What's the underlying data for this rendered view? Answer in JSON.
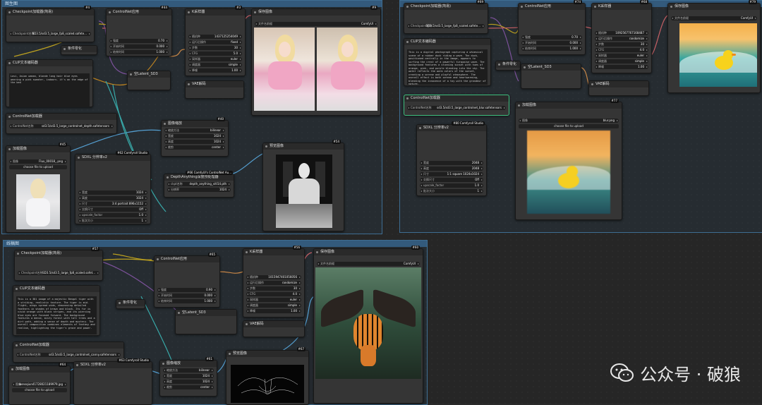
{
  "groups": {
    "g1": {
      "title": "图生图"
    },
    "g2": {
      "title": ""
    },
    "g3": {
      "title": "线稿图"
    }
  },
  "watermark": {
    "text": "公众号 · 破狼",
    "icon": "wechat-icon"
  },
  "panel1": {
    "checkpoint": {
      "title": "Checkpoint加载器(简易)",
      "badge": "#4",
      "widget_label": "Checkpoint名称",
      "widget_value": "SD3.5/sd3.5_large_fp8_scaled.safete..."
    },
    "clip": {
      "title": "CLIP文本编码器",
      "text": "Lovi, Asian woman, blonde long hair blue eyes wearing a pink sweater, indoors. it's on the edge of the bed"
    },
    "neg": {
      "title": "条件零化"
    },
    "controlnet_apply": {
      "title": "ControlNet应用",
      "badge": "#44",
      "rows": [
        [
          "强度",
          "0.70"
        ],
        [
          "开始时间",
          "0.000"
        ],
        [
          "结束时间",
          "1.000"
        ]
      ]
    },
    "ksampler": {
      "title": "K采样器",
      "badge": "#3",
      "rows": [
        [
          "随机种",
          "1437125254049"
        ],
        [
          "运行后操作",
          "fixed"
        ],
        [
          "步数",
          "30"
        ],
        [
          "CFG",
          "5.0"
        ],
        [
          "采样器",
          "euler"
        ],
        [
          "调度器",
          "simple"
        ],
        [
          "降噪",
          "1.00"
        ]
      ]
    },
    "save": {
      "title": "保存图像",
      "badge": "#9",
      "prefix_label": "文件名前缀",
      "prefix_value": "ComfyUI"
    },
    "latent": {
      "title": "空Latent_SD3"
    },
    "vae": {
      "title": "VAE解码"
    },
    "cn_loader": {
      "title": "ControlNet加载器",
      "widget_label": "ControlNet名称",
      "widget_value": "sd3.5/sd3.5_large_controlnet_depth.safetensors"
    },
    "resize": {
      "title": "图像缩放",
      "badge": "#40",
      "rows": [
        [
          "缩放方法",
          "bilinear"
        ],
        [
          "宽度",
          "1024"
        ],
        [
          "高度",
          "1024"
        ],
        [
          "裁剪",
          "center"
        ]
      ]
    },
    "load_img": {
      "title": "加载图像",
      "badge": "#45",
      "file_label": "图像",
      "file_value": "Flux_00018_.png",
      "upload": "choose file to upload"
    },
    "sdxl": {
      "title": "SDXL 分辨率v2",
      "badge": "#62 Comfyroll Studio",
      "rows": [
        [
          "宽度",
          "1024"
        ],
        [
          "高度",
          "1024"
        ],
        [
          "尺寸",
          "3:4 portrait 896x1152"
        ],
        [
          "交换尺寸",
          "Off"
        ],
        [
          "upscale_factor",
          "1.0"
        ],
        [
          "批次大小",
          "1"
        ]
      ]
    },
    "depth": {
      "title": "DepthAnything深度预处理器",
      "badge": "#66 ComfyUI's ControlNet Au...",
      "rows": [
        [
          "ckpt名称",
          "depth_anything_vitl14.pth"
        ],
        [
          "分辨率",
          "1024"
        ]
      ]
    },
    "preview": {
      "title": "预览图像",
      "badge": "#54"
    }
  },
  "panel2": {
    "checkpoint": {
      "title": "Checkpoint加载器(简易)",
      "badge": "#69",
      "widget_label": "Checkpoint名称",
      "widget_value": "SD3.5/sd3.5_large_fp8_scaled.safete..."
    },
    "clip": {
      "title": "CLIP文本编码器",
      "text": "This is a digital photograph capturing a whimsical scene of a rubber duck riding a wave. The duck, positioned centrally in the image, appears to surfing the crest of a powerful turquoise wave. The background features a stunning sunset with hues of orange, pink, and purple blending into the sky. The water reflects the warm colors of the sunset, creating a serene and playful atmosphere. The overall effect is both serene and heartwarming, blending the innocence of a toy with the grandeur of nature."
    },
    "neg": {
      "title": "条件零化"
    },
    "controlnet_apply": {
      "title": "ControlNet应用",
      "badge": "#74",
      "rows": [
        [
          "强度",
          "0.70"
        ],
        [
          "开始时间",
          "0.000"
        ],
        [
          "结束时间",
          "1.000"
        ]
      ]
    },
    "ksampler": {
      "title": "K采样器",
      "badge": "#68",
      "rows": [
        [
          "随机种",
          "1092567767168487"
        ],
        [
          "运行后操作",
          "randomize"
        ],
        [
          "步数",
          "30"
        ],
        [
          "CFG",
          "4.0"
        ],
        [
          "采样器",
          "euler"
        ],
        [
          "调度器",
          "simple"
        ],
        [
          "降噪",
          "1.00"
        ]
      ]
    },
    "save": {
      "title": "保存图像",
      "badge": "#79",
      "prefix_label": "文件名前缀",
      "prefix_value": "ComfyUI"
    },
    "latent": {
      "title": "空Latent_SD3"
    },
    "vae": {
      "title": "VAE解码"
    },
    "cn_loader": {
      "title": "ControlNet加载器",
      "widget_label": "ControlNet名称",
      "widget_value": "sd3.5/sd3.5_large_controlnet_blur.safetensors"
    },
    "load_img": {
      "title": "加载图像",
      "badge": "#77",
      "file_label": "图像",
      "file_value": "blur.png",
      "upload": "choose file to upload"
    },
    "sdxl": {
      "title": "SDXL 分辨率v2",
      "badge": "#80 Comfyroll Studio",
      "rows": [
        [
          "宽度",
          "2048"
        ],
        [
          "高度",
          "2048"
        ],
        [
          "尺寸",
          "1:1 square 1024x1024"
        ],
        [
          "交换尺寸",
          "Off"
        ],
        [
          "upscale_factor",
          "1.0"
        ],
        [
          "批次大小",
          "1"
        ]
      ]
    }
  },
  "panel3": {
    "checkpoint": {
      "title": "Checkpoint加载器(简易)",
      "badge": "#57",
      "widget_label": "Checkpoint名称",
      "widget_value": "SD3.5/sd3.5_large_fp8_scaled.safet..."
    },
    "clip": {
      "title": "CLIP文本编码器",
      "text": "This is a 3D1 image of a majestic Bengal tiger with a striking, realistic texture. The tiger is mid-flight, wings spread wide, showcasing detailed feathers in shades of brown and black. Its fur is vivid orange with black stripes, and its piercing blue eyes are focused forward. The background features a dense, misty forest with tall trees and a dirt path, adding a sense of depth and mystery. The overall composition combines elements of fantasy and realism, highlighting the tiger's grace and power."
    },
    "neg": {
      "title": "条件零化"
    },
    "controlnet_apply": {
      "title": "ControlNet应用",
      "badge": "#65",
      "rows": [
        [
          "强度",
          "0.90"
        ],
        [
          "开始时间",
          "0.000"
        ],
        [
          "结束时间",
          "1.000"
        ]
      ]
    },
    "ksampler": {
      "title": "K采样器",
      "badge": "#56",
      "rows": [
        [
          "随机种",
          "1015947401056056"
        ],
        [
          "运行后操作",
          "randomize"
        ],
        [
          "步数",
          "30"
        ],
        [
          "CFG",
          "4.0"
        ],
        [
          "采样器",
          "euler"
        ],
        [
          "调度器",
          "simple"
        ],
        [
          "降噪",
          "1.00"
        ]
      ]
    },
    "save": {
      "title": "保存图像",
      "badge": "#60",
      "prefix_label": "文件名前缀",
      "prefix_value": "ComfyUI"
    },
    "latent": {
      "title": "空Latent_SD3"
    },
    "vae": {
      "title": "VAE解码"
    },
    "cn_loader": {
      "title": "ControlNet加载器",
      "widget_label": "ControlNet名称",
      "widget_value": "sd3.5/sd3.5_large_controlnet_canny.safetensors"
    },
    "resize": {
      "title": "图像缩放",
      "badge": "#61",
      "rows": [
        [
          "缩放方法",
          "bilinear"
        ],
        [
          "宽度",
          "1024"
        ],
        [
          "高度",
          "1024"
        ],
        [
          "裁剪",
          "center"
        ]
      ]
    },
    "load_img": {
      "title": "加载图像",
      "badge": "#64",
      "file_label": "图像",
      "file_value": "wensqiun41728021189979.jpg",
      "upload": "choose file to upload"
    },
    "sdxl": {
      "title": "SDXL 分辨率v2",
      "badge": "#63 Comfyroll Studio"
    },
    "preview": {
      "title": "预览图像",
      "badge": "#67"
    }
  }
}
